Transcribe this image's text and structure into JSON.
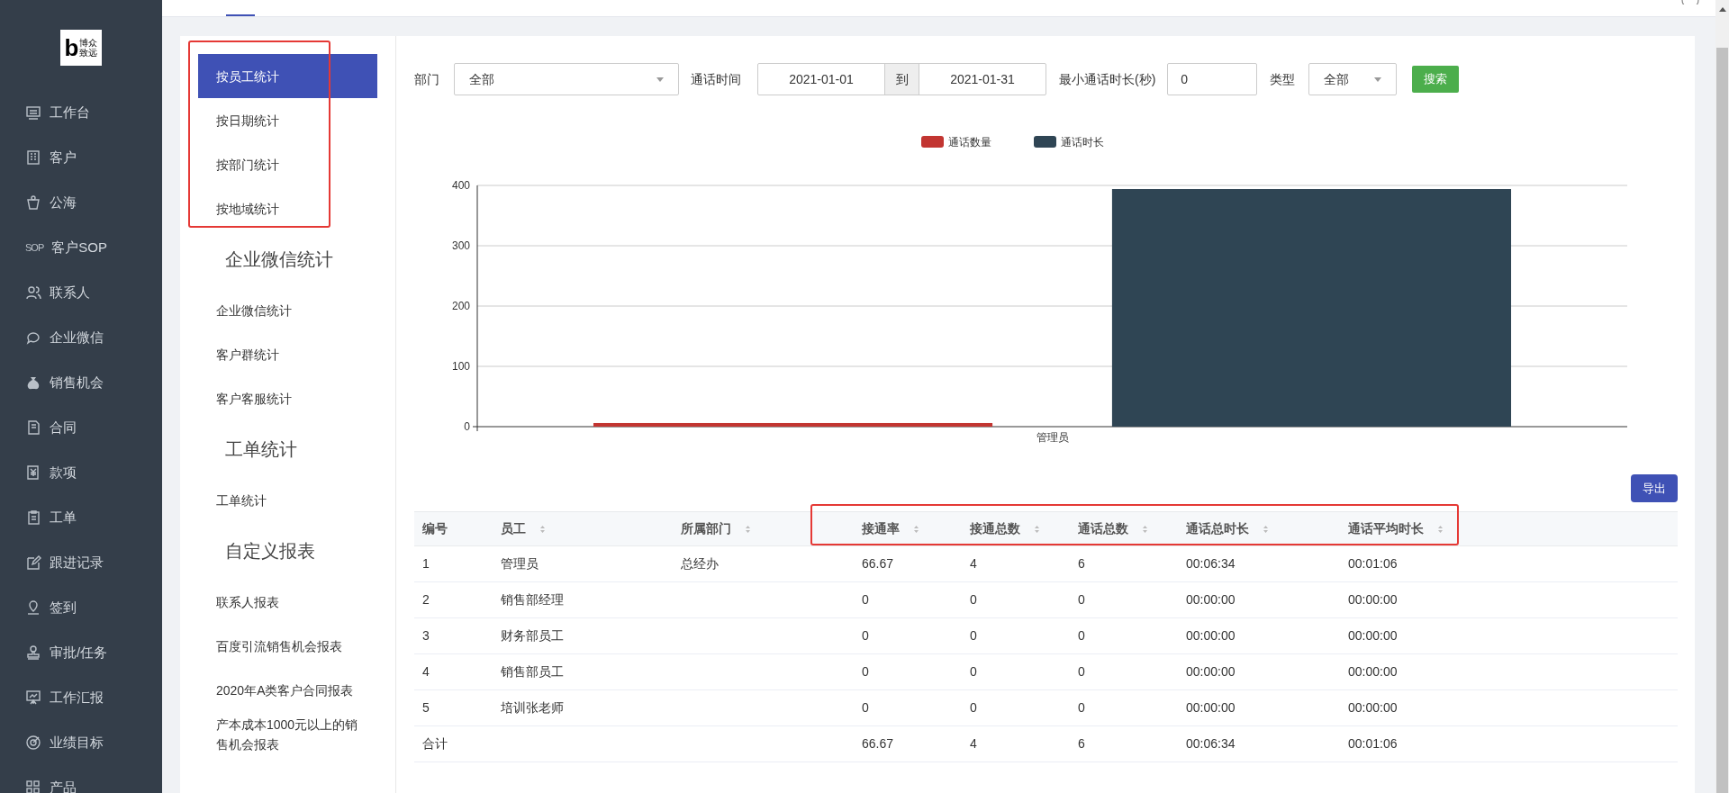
{
  "logo": {
    "mark": "b",
    "lines": [
      "博众",
      "致远"
    ]
  },
  "sidebar": {
    "items": [
      {
        "label": "工作台"
      },
      {
        "label": "客户"
      },
      {
        "label": "公海"
      },
      {
        "label": "客户SOP",
        "icon_text": "SOP"
      },
      {
        "label": "联系人"
      },
      {
        "label": "企业微信"
      },
      {
        "label": "销售机会"
      },
      {
        "label": "合同"
      },
      {
        "label": "款项"
      },
      {
        "label": "工单"
      },
      {
        "label": "跟进记录"
      },
      {
        "label": "签到"
      },
      {
        "label": "审批/任务"
      },
      {
        "label": "工作汇报"
      },
      {
        "label": "业绩目标"
      },
      {
        "label": "产品"
      }
    ]
  },
  "subnav": [
    {
      "kind": "item",
      "label": "按员工统计",
      "selected": true
    },
    {
      "kind": "item",
      "label": "按日期统计",
      "selected": false
    },
    {
      "kind": "item",
      "label": "按部门统计",
      "selected": false
    },
    {
      "kind": "item",
      "label": "按地域统计",
      "selected": false
    },
    {
      "kind": "heading",
      "label": "企业微信统计"
    },
    {
      "kind": "item",
      "label": "企业微信统计",
      "selected": false
    },
    {
      "kind": "item",
      "label": "客户群统计",
      "selected": false
    },
    {
      "kind": "item",
      "label": "客户客服统计",
      "selected": false
    },
    {
      "kind": "heading",
      "label": "工单统计"
    },
    {
      "kind": "item",
      "label": "工单统计",
      "selected": false
    },
    {
      "kind": "heading",
      "label": "自定义报表"
    },
    {
      "kind": "item",
      "label": "联系人报表",
      "selected": false
    },
    {
      "kind": "item",
      "label": "百度引流销售机会报表",
      "selected": false
    },
    {
      "kind": "item",
      "label": "2020年A类客户合同报表",
      "selected": false
    },
    {
      "kind": "item",
      "label": "产本成本1000元以上的销售机会报表",
      "selected": false
    }
  ],
  "filters": {
    "department_label": "部门",
    "department_value": "全部",
    "time_label": "通话时间",
    "date_from": "2021-01-01",
    "date_sep": "到",
    "date_to": "2021-01-31",
    "min_label": "最小通话时长(秒)",
    "min_value": "0",
    "type_label": "类型",
    "type_value": "全部",
    "search_button": "搜索"
  },
  "chart_data": {
    "type": "bar",
    "categories": [
      "管理员"
    ],
    "series": [
      {
        "name": "通话数量",
        "color": "#c23531",
        "values": [
          6
        ]
      },
      {
        "name": "通话时长",
        "color": "#2f4554",
        "values": [
          394
        ]
      }
    ],
    "ylim": [
      0,
      400
    ],
    "yticks": [
      0,
      100,
      200,
      300,
      400
    ],
    "grid": true,
    "legend": true
  },
  "export_button": "导出",
  "table": {
    "columns": [
      {
        "label": "编号",
        "sortable": false
      },
      {
        "label": "员工",
        "sortable": true
      },
      {
        "label": "所属部门",
        "sortable": true
      },
      {
        "label": "接通率",
        "sortable": true
      },
      {
        "label": "接通总数",
        "sortable": true
      },
      {
        "label": "通话总数",
        "sortable": true
      },
      {
        "label": "通话总时长",
        "sortable": true
      },
      {
        "label": "通话平均时长",
        "sortable": true
      }
    ],
    "rows": [
      [
        "1",
        "管理员",
        "总经办",
        "66.67",
        "4",
        "6",
        "00:06:34",
        "00:01:06"
      ],
      [
        "2",
        "销售部经理",
        "",
        "0",
        "0",
        "0",
        "00:00:00",
        "00:00:00"
      ],
      [
        "3",
        "财务部员工",
        "",
        "0",
        "0",
        "0",
        "00:00:00",
        "00:00:00"
      ],
      [
        "4",
        "销售部员工",
        "",
        "0",
        "0",
        "0",
        "00:00:00",
        "00:00:00"
      ],
      [
        "5",
        "培训张老师",
        "",
        "0",
        "0",
        "0",
        "00:00:00",
        "00:00:00"
      ],
      [
        "合计",
        "",
        "",
        "66.67",
        "4",
        "6",
        "00:06:34",
        "00:01:06"
      ]
    ]
  }
}
